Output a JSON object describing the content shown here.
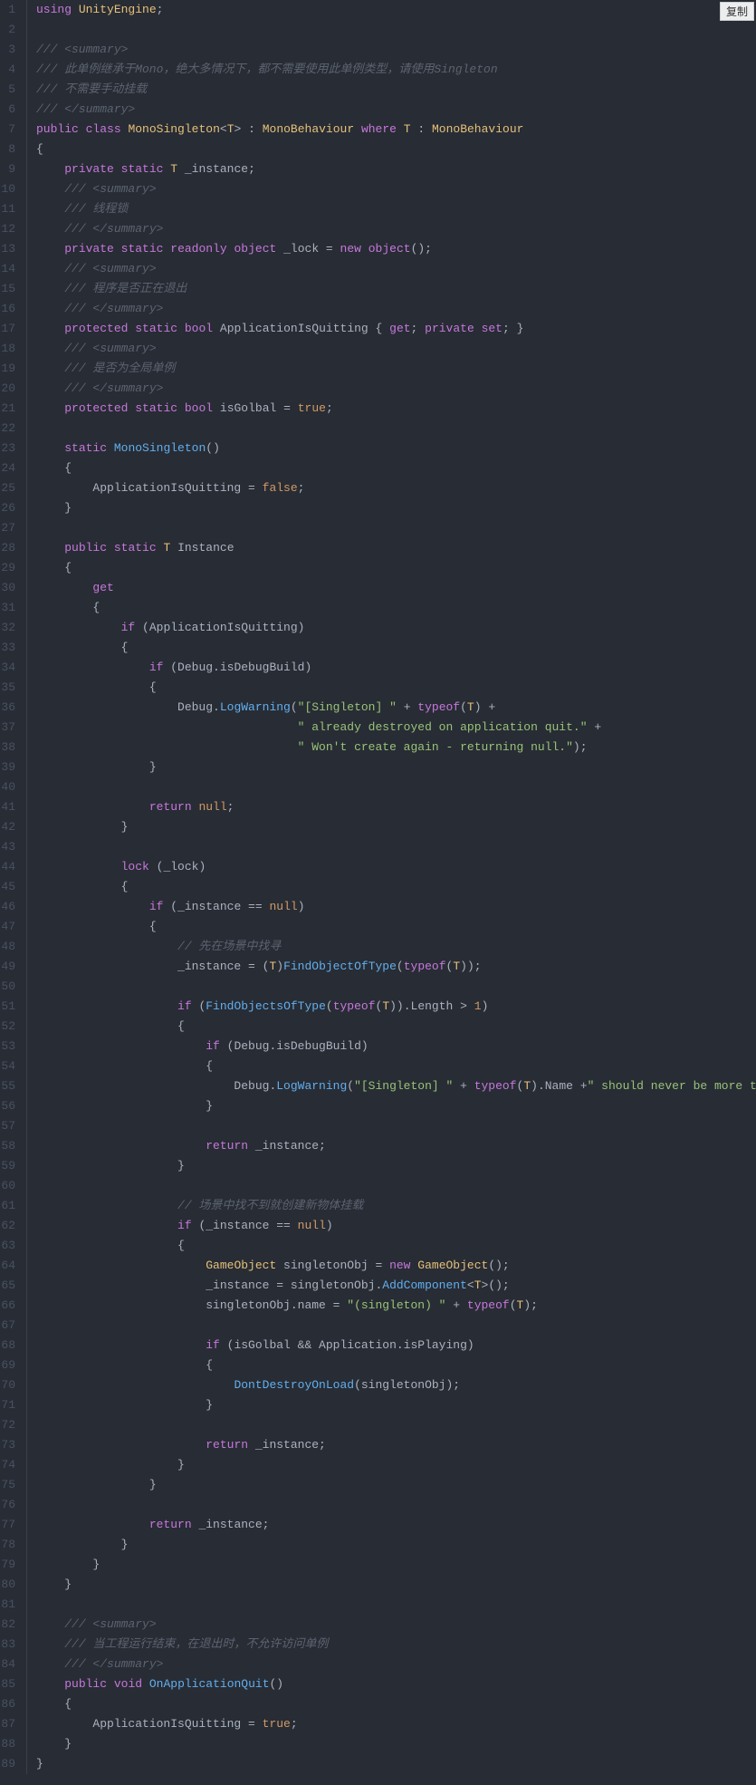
{
  "copy_button": "复制",
  "line_count": 89,
  "code_lines": [
    [
      [
        "kw",
        "using"
      ],
      [
        "op",
        " "
      ],
      [
        "type",
        "UnityEngine"
      ],
      [
        "op",
        ";"
      ]
    ],
    [],
    [
      [
        "cmt",
        "/// <summary>"
      ]
    ],
    [
      [
        "cmt",
        "/// 此单例继承于Mono，绝大多情况下，都不需要使用此单例类型，请使用Singleton"
      ]
    ],
    [
      [
        "cmt",
        "/// 不需要手动挂载"
      ]
    ],
    [
      [
        "cmt",
        "/// </summary>"
      ]
    ],
    [
      [
        "kw",
        "public"
      ],
      [
        "op",
        " "
      ],
      [
        "kw",
        "class"
      ],
      [
        "op",
        " "
      ],
      [
        "type",
        "MonoSingleton"
      ],
      [
        "op",
        "<"
      ],
      [
        "type",
        "T"
      ],
      [
        "op",
        "> : "
      ],
      [
        "type",
        "MonoBehaviour"
      ],
      [
        "op",
        " "
      ],
      [
        "kw",
        "where"
      ],
      [
        "op",
        " "
      ],
      [
        "type",
        "T"
      ],
      [
        "op",
        " : "
      ],
      [
        "type",
        "MonoBehaviour"
      ]
    ],
    [
      [
        "op",
        "{"
      ]
    ],
    [
      [
        "op",
        "    "
      ],
      [
        "kw",
        "private"
      ],
      [
        "op",
        " "
      ],
      [
        "kw",
        "static"
      ],
      [
        "op",
        " "
      ],
      [
        "type",
        "T"
      ],
      [
        "op",
        " _instance;"
      ]
    ],
    [
      [
        "op",
        "    "
      ],
      [
        "cmt",
        "/// <summary>"
      ]
    ],
    [
      [
        "op",
        "    "
      ],
      [
        "cmt",
        "/// 线程锁"
      ]
    ],
    [
      [
        "op",
        "    "
      ],
      [
        "cmt",
        "/// </summary>"
      ]
    ],
    [
      [
        "op",
        "    "
      ],
      [
        "kw",
        "private"
      ],
      [
        "op",
        " "
      ],
      [
        "kw",
        "static"
      ],
      [
        "op",
        " "
      ],
      [
        "kw",
        "readonly"
      ],
      [
        "op",
        " "
      ],
      [
        "kw",
        "object"
      ],
      [
        "op",
        " _lock = "
      ],
      [
        "kw",
        "new"
      ],
      [
        "op",
        " "
      ],
      [
        "kw",
        "object"
      ],
      [
        "op",
        "();"
      ]
    ],
    [
      [
        "op",
        "    "
      ],
      [
        "cmt",
        "/// <summary>"
      ]
    ],
    [
      [
        "op",
        "    "
      ],
      [
        "cmt",
        "/// 程序是否正在退出"
      ]
    ],
    [
      [
        "op",
        "    "
      ],
      [
        "cmt",
        "/// </summary>"
      ]
    ],
    [
      [
        "op",
        "    "
      ],
      [
        "kw",
        "protected"
      ],
      [
        "op",
        " "
      ],
      [
        "kw",
        "static"
      ],
      [
        "op",
        " "
      ],
      [
        "kw",
        "bool"
      ],
      [
        "op",
        " ApplicationIsQuitting { "
      ],
      [
        "kw",
        "get"
      ],
      [
        "op",
        "; "
      ],
      [
        "kw",
        "private"
      ],
      [
        "op",
        " "
      ],
      [
        "kw",
        "set"
      ],
      [
        "op",
        "; }"
      ]
    ],
    [
      [
        "op",
        "    "
      ],
      [
        "cmt",
        "/// <summary>"
      ]
    ],
    [
      [
        "op",
        "    "
      ],
      [
        "cmt",
        "/// 是否为全局单例"
      ]
    ],
    [
      [
        "op",
        "    "
      ],
      [
        "cmt",
        "/// </summary>"
      ]
    ],
    [
      [
        "op",
        "    "
      ],
      [
        "kw",
        "protected"
      ],
      [
        "op",
        " "
      ],
      [
        "kw",
        "static"
      ],
      [
        "op",
        " "
      ],
      [
        "kw",
        "bool"
      ],
      [
        "op",
        " isGolbal = "
      ],
      [
        "const",
        "true"
      ],
      [
        "op",
        ";"
      ]
    ],
    [],
    [
      [
        "op",
        "    "
      ],
      [
        "kw",
        "static"
      ],
      [
        "op",
        " "
      ],
      [
        "fn",
        "MonoSingleton"
      ],
      [
        "op",
        "()"
      ]
    ],
    [
      [
        "op",
        "    {"
      ]
    ],
    [
      [
        "op",
        "        ApplicationIsQuitting = "
      ],
      [
        "const",
        "false"
      ],
      [
        "op",
        ";"
      ]
    ],
    [
      [
        "op",
        "    }"
      ]
    ],
    [],
    [
      [
        "op",
        "    "
      ],
      [
        "kw",
        "public"
      ],
      [
        "op",
        " "
      ],
      [
        "kw",
        "static"
      ],
      [
        "op",
        " "
      ],
      [
        "type",
        "T"
      ],
      [
        "op",
        " Instance"
      ]
    ],
    [
      [
        "op",
        "    {"
      ]
    ],
    [
      [
        "op",
        "        "
      ],
      [
        "kw",
        "get"
      ]
    ],
    [
      [
        "op",
        "        {"
      ]
    ],
    [
      [
        "op",
        "            "
      ],
      [
        "kw",
        "if"
      ],
      [
        "op",
        " (ApplicationIsQuitting)"
      ]
    ],
    [
      [
        "op",
        "            {"
      ]
    ],
    [
      [
        "op",
        "                "
      ],
      [
        "kw",
        "if"
      ],
      [
        "op",
        " (Debug.isDebugBuild)"
      ]
    ],
    [
      [
        "op",
        "                {"
      ]
    ],
    [
      [
        "op",
        "                    Debug."
      ],
      [
        "fn",
        "LogWarning"
      ],
      [
        "op",
        "("
      ],
      [
        "str",
        "\"[Singleton] \""
      ],
      [
        "op",
        " + "
      ],
      [
        "kw",
        "typeof"
      ],
      [
        "op",
        "("
      ],
      [
        "type",
        "T"
      ],
      [
        "op",
        ") +"
      ]
    ],
    [
      [
        "op",
        "                                     "
      ],
      [
        "str",
        "\" already destroyed on application quit.\""
      ],
      [
        "op",
        " +"
      ]
    ],
    [
      [
        "op",
        "                                     "
      ],
      [
        "str",
        "\" Won't create again - returning null.\""
      ],
      [
        "op",
        ");"
      ]
    ],
    [
      [
        "op",
        "                }"
      ]
    ],
    [],
    [
      [
        "op",
        "                "
      ],
      [
        "kw",
        "return"
      ],
      [
        "op",
        " "
      ],
      [
        "const",
        "null"
      ],
      [
        "op",
        ";"
      ]
    ],
    [
      [
        "op",
        "            }"
      ]
    ],
    [],
    [
      [
        "op",
        "            "
      ],
      [
        "kw",
        "lock"
      ],
      [
        "op",
        " (_lock)"
      ]
    ],
    [
      [
        "op",
        "            {"
      ]
    ],
    [
      [
        "op",
        "                "
      ],
      [
        "kw",
        "if"
      ],
      [
        "op",
        " (_instance == "
      ],
      [
        "const",
        "null"
      ],
      [
        "op",
        ")"
      ]
    ],
    [
      [
        "op",
        "                {"
      ]
    ],
    [
      [
        "op",
        "                    "
      ],
      [
        "cmt",
        "// 先在场景中找寻"
      ]
    ],
    [
      [
        "op",
        "                    _instance = ("
      ],
      [
        "type",
        "T"
      ],
      [
        "op",
        ")"
      ],
      [
        "fn",
        "FindObjectOfType"
      ],
      [
        "op",
        "("
      ],
      [
        "kw",
        "typeof"
      ],
      [
        "op",
        "("
      ],
      [
        "type",
        "T"
      ],
      [
        "op",
        "));"
      ]
    ],
    [],
    [
      [
        "op",
        "                    "
      ],
      [
        "kw",
        "if"
      ],
      [
        "op",
        " ("
      ],
      [
        "fn",
        "FindObjectsOfType"
      ],
      [
        "op",
        "("
      ],
      [
        "kw",
        "typeof"
      ],
      [
        "op",
        "("
      ],
      [
        "type",
        "T"
      ],
      [
        "op",
        ")).Length > "
      ],
      [
        "num",
        "1"
      ],
      [
        "op",
        ")"
      ]
    ],
    [
      [
        "op",
        "                    {"
      ]
    ],
    [
      [
        "op",
        "                        "
      ],
      [
        "kw",
        "if"
      ],
      [
        "op",
        " (Debug.isDebugBuild)"
      ]
    ],
    [
      [
        "op",
        "                        {"
      ]
    ],
    [
      [
        "op",
        "                            Debug."
      ],
      [
        "fn",
        "LogWarning"
      ],
      [
        "op",
        "("
      ],
      [
        "str",
        "\"[Singleton] \""
      ],
      [
        "op",
        " + "
      ],
      [
        "kw",
        "typeof"
      ],
      [
        "op",
        "("
      ],
      [
        "type",
        "T"
      ],
      [
        "op",
        ").Name +"
      ],
      [
        "str",
        "\" should never be more th"
      ]
    ],
    [
      [
        "op",
        "                        }"
      ]
    ],
    [],
    [
      [
        "op",
        "                        "
      ],
      [
        "kw",
        "return"
      ],
      [
        "op",
        " _instance;"
      ]
    ],
    [
      [
        "op",
        "                    }"
      ]
    ],
    [],
    [
      [
        "op",
        "                    "
      ],
      [
        "cmt",
        "// 场景中找不到就创建新物体挂载"
      ]
    ],
    [
      [
        "op",
        "                    "
      ],
      [
        "kw",
        "if"
      ],
      [
        "op",
        " (_instance == "
      ],
      [
        "const",
        "null"
      ],
      [
        "op",
        ")"
      ]
    ],
    [
      [
        "op",
        "                    {"
      ]
    ],
    [
      [
        "op",
        "                        "
      ],
      [
        "type",
        "GameObject"
      ],
      [
        "op",
        " singletonObj = "
      ],
      [
        "kw",
        "new"
      ],
      [
        "op",
        " "
      ],
      [
        "type",
        "GameObject"
      ],
      [
        "op",
        "();"
      ]
    ],
    [
      [
        "op",
        "                        _instance = singletonObj."
      ],
      [
        "fn",
        "AddComponent"
      ],
      [
        "op",
        "<"
      ],
      [
        "type",
        "T"
      ],
      [
        "op",
        ">();"
      ]
    ],
    [
      [
        "op",
        "                        singletonObj.name = "
      ],
      [
        "str",
        "\"(singleton) \""
      ],
      [
        "op",
        " + "
      ],
      [
        "kw",
        "typeof"
      ],
      [
        "op",
        "("
      ],
      [
        "type",
        "T"
      ],
      [
        "op",
        ");"
      ]
    ],
    [],
    [
      [
        "op",
        "                        "
      ],
      [
        "kw",
        "if"
      ],
      [
        "op",
        " (isGolbal && Application.isPlaying)"
      ]
    ],
    [
      [
        "op",
        "                        {"
      ]
    ],
    [
      [
        "op",
        "                            "
      ],
      [
        "fn",
        "DontDestroyOnLoad"
      ],
      [
        "op",
        "(singletonObj);"
      ]
    ],
    [
      [
        "op",
        "                        }"
      ]
    ],
    [],
    [
      [
        "op",
        "                        "
      ],
      [
        "kw",
        "return"
      ],
      [
        "op",
        " _instance;"
      ]
    ],
    [
      [
        "op",
        "                    }"
      ]
    ],
    [
      [
        "op",
        "                }"
      ]
    ],
    [],
    [
      [
        "op",
        "                "
      ],
      [
        "kw",
        "return"
      ],
      [
        "op",
        " _instance;"
      ]
    ],
    [
      [
        "op",
        "            }"
      ]
    ],
    [
      [
        "op",
        "        }"
      ]
    ],
    [
      [
        "op",
        "    }"
      ]
    ],
    [],
    [
      [
        "op",
        "    "
      ],
      [
        "cmt",
        "/// <summary>"
      ]
    ],
    [
      [
        "op",
        "    "
      ],
      [
        "cmt",
        "/// 当工程运行结束，在退出时，不允许访问单例"
      ]
    ],
    [
      [
        "op",
        "    "
      ],
      [
        "cmt",
        "/// </summary>"
      ]
    ],
    [
      [
        "op",
        "    "
      ],
      [
        "kw",
        "public"
      ],
      [
        "op",
        " "
      ],
      [
        "kw",
        "void"
      ],
      [
        "op",
        " "
      ],
      [
        "fn",
        "OnApplicationQuit"
      ],
      [
        "op",
        "()"
      ]
    ],
    [
      [
        "op",
        "    {"
      ]
    ],
    [
      [
        "op",
        "        ApplicationIsQuitting = "
      ],
      [
        "const",
        "true"
      ],
      [
        "op",
        ";"
      ]
    ],
    [
      [
        "op",
        "    }"
      ]
    ],
    [
      [
        "op",
        "}"
      ]
    ]
  ]
}
